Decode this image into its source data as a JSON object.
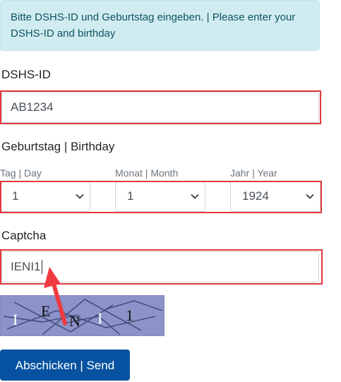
{
  "alert": {
    "text": "Bitte DSHS-ID und Geburtstag eingeben. | Please enter your DSHS-ID and birthday"
  },
  "dshs_id": {
    "label": "DSHS-ID",
    "value": "AB1234"
  },
  "birthday": {
    "label": "Geburtstag | Birthday",
    "day": {
      "label": "Tag | Day",
      "value": "1"
    },
    "month": {
      "label": "Monat | Month",
      "value": "1"
    },
    "year": {
      "label": "Jahr | Year",
      "value": "1924"
    }
  },
  "captcha": {
    "label": "Captcha",
    "value": "IENI1",
    "image_chars": [
      "I",
      "E",
      "N",
      "I",
      "1"
    ]
  },
  "submit": {
    "label": "Abschicken | Send"
  },
  "colors": {
    "highlight": "#e0393e",
    "button": "#0752a0",
    "alert_bg": "#d1ecf1",
    "captcha_bg": "#8b93c9"
  },
  "icons": [
    "chevron-down-icon",
    "annotation-arrow-icon"
  ]
}
